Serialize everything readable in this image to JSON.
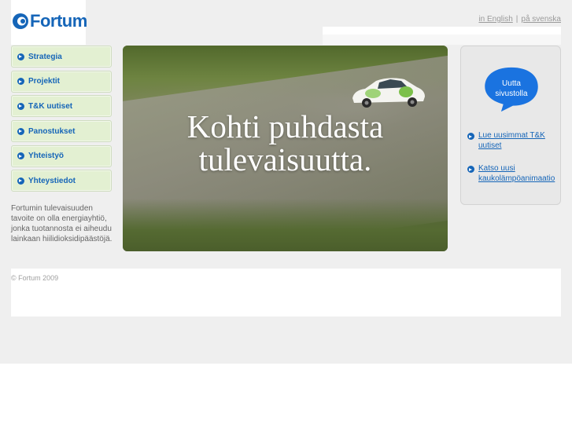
{
  "brand": {
    "name": "Fortum",
    "color": "#1565b8"
  },
  "languages": {
    "english": "in English",
    "separator": "|",
    "swedish": "på svenska"
  },
  "nav": {
    "items": [
      {
        "label": "Strategia"
      },
      {
        "label": "Projektit"
      },
      {
        "label": "T&K uutiset"
      },
      {
        "label": "Panostukset"
      },
      {
        "label": "Yhteistyö"
      },
      {
        "label": "Yhteystiedot"
      }
    ]
  },
  "intro": {
    "text": "Fortumin tulevaisuuden tavoite on olla energiayhtiö, jonka tuotannosta ei aiheudu lainkaan hiilidioksidipäästöjä."
  },
  "hero": {
    "line1": "Kohti puhdasta",
    "line2": "tulevaisuutta."
  },
  "side_panel": {
    "bubble": {
      "line1": "Uutta",
      "line2": "sivustolla"
    },
    "links": [
      {
        "label": "Lue uusimmat T&K uutiset"
      },
      {
        "label": "Katso uusi kaukolämpöanimaatio"
      }
    ]
  },
  "footer": {
    "copyright": "© Fortum 2009"
  }
}
